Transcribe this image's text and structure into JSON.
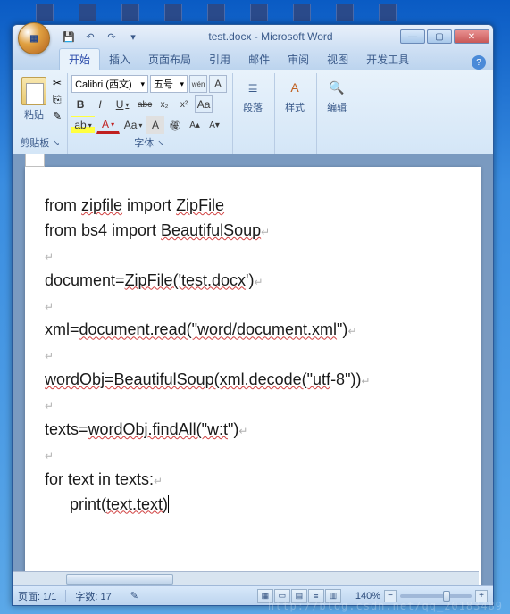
{
  "window": {
    "title": "test.docx - Microsoft Word",
    "office_glyph": "▦"
  },
  "qat": {
    "save": "💾",
    "undo": "↶",
    "redo": "↷",
    "more": "▾"
  },
  "winbtns": {
    "min": "—",
    "max": "▢",
    "close": "✕"
  },
  "tabs": {
    "home": "开始",
    "insert": "插入",
    "layout": "页面布局",
    "reference": "引用",
    "mail": "邮件",
    "review": "审阅",
    "view": "视图",
    "dev": "开发工具"
  },
  "help": "?",
  "clipboard": {
    "paste": "粘贴",
    "cut": "✂",
    "copy": "⎘",
    "fmtpaint": "✎",
    "group": "剪贴板",
    "launcher": "↘"
  },
  "font": {
    "name": "Calibri (西文)",
    "name_drop": "▾",
    "size": "五号",
    "size_drop": "▾",
    "pinyin": "wén",
    "charborder": "A",
    "bold": "B",
    "italic": "I",
    "underline": "U",
    "ul_drop": "▾",
    "strike": "abc",
    "sub": "x₂",
    "sup": "x²",
    "clear": "Aa",
    "highlight": "ab",
    "hl_drop": "▾",
    "fontcolor": "A",
    "fc_drop": "▾",
    "changecase": "Aa",
    "cc_drop": "▾",
    "charshade": "A",
    "enclosed": "㊝",
    "grow": "A▴",
    "shrink": "A▾",
    "group": "字体",
    "launcher": "↘"
  },
  "paragraph": {
    "icon": "≣",
    "label": "段落"
  },
  "styles": {
    "icon": "A",
    "label": "样式"
  },
  "editing": {
    "icon": "🔍",
    "label": "编辑"
  },
  "document": {
    "lines": [
      {
        "t": "from zipfile import ZipFile",
        "sq": [
          "zipfile",
          "ZipFile"
        ]
      },
      {
        "t": "from bs4 import BeautifulSoup",
        "sq": [
          "BeautifulSoup"
        ],
        "mark": true
      },
      {
        "t": "",
        "mark": true
      },
      {
        "t": "document=ZipFile('test.docx')",
        "sq": [
          "ZipFile('test.docx"
        ],
        "mark": true
      },
      {
        "t": "",
        "mark": true
      },
      {
        "t": "xml=document.read(\"word/document.xml\")",
        "sq": [
          "document.read(\"word/document.xml"
        ],
        "mark": true
      },
      {
        "t": "",
        "mark": true
      },
      {
        "t": "wordObj=BeautifulSoup(xml.decode(\"utf-8\"))",
        "sq": [
          "wordObj=BeautifulSoup(xml.decode(\"utf"
        ],
        "mark": true
      },
      {
        "t": "",
        "mark": true
      },
      {
        "t": "texts=wordObj.findAll(\"w:t\")",
        "sq": [
          "wordObj.findAll(\"w:t"
        ],
        "mark": true
      },
      {
        "t": "",
        "mark": true
      },
      {
        "t": "for text in texts:",
        "sq": [],
        "mark": true
      },
      {
        "t": "print(text.text)",
        "sq": [
          "text.text"
        ],
        "indent": true,
        "cursor": true
      }
    ]
  },
  "status": {
    "page": "页面: 1/1",
    "words": "字数: 17",
    "proof": "✎",
    "zoom": "140%",
    "minus": "−",
    "plus": "+"
  },
  "watermark": "http://blog.csdn.net/qq_20183489"
}
